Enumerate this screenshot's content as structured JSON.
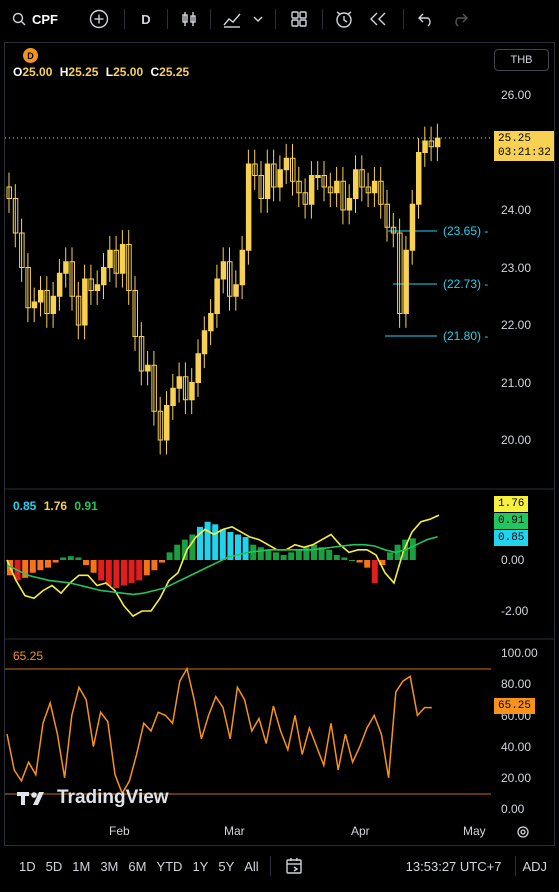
{
  "toolbar": {
    "symbol": "CPF",
    "interval": "D",
    "icons": [
      "search-icon",
      "add-symbol-icon",
      "bar-style-icon",
      "indicators-icon",
      "chevron-down-icon",
      "layout-icon",
      "alert-icon",
      "replay-icon",
      "undo-icon",
      "redo-icon"
    ]
  },
  "chart": {
    "interval_badge": "D",
    "currency": "THB",
    "ohlc": {
      "o_label": "O",
      "o": "25.00",
      "h_label": "H",
      "h": "25.25",
      "l_label": "L",
      "l": "25.00",
      "c_label": "C",
      "c": "25.25"
    },
    "last_price": "25.25",
    "countdown": "03:21:32",
    "price_axis": [
      "26.00",
      "24.00",
      "23.00",
      "22.00",
      "21.00",
      "20.00"
    ],
    "levels": [
      "(23.65) -",
      "(22.73) -",
      "(21.80) -"
    ],
    "colors": {
      "up": "#f7d154",
      "level": "#22d3ee",
      "rsi": "#f7931a"
    }
  },
  "indicator": {
    "legend": {
      "a": "0.85",
      "b": "1.76",
      "c": "0.91"
    },
    "axis": [
      "0.00",
      "-2.00"
    ],
    "tags": {
      "yellow": "1.76",
      "green": "0.91",
      "cyan": "0.85"
    }
  },
  "rsi": {
    "legend": "65.25",
    "axis": [
      "100.00",
      "80.00",
      "60.00",
      "40.00",
      "20.00",
      "0.00"
    ],
    "tag": "65.25"
  },
  "time_axis": [
    "Feb",
    "Mar",
    "Apr",
    "May"
  ],
  "watermark": "TradingView",
  "bottom": {
    "ranges": [
      "1D",
      "5D",
      "1M",
      "3M",
      "6M",
      "YTD",
      "1Y",
      "5Y",
      "All"
    ],
    "clock": "13:53:27 UTC+7",
    "adj": "ADJ"
  }
}
